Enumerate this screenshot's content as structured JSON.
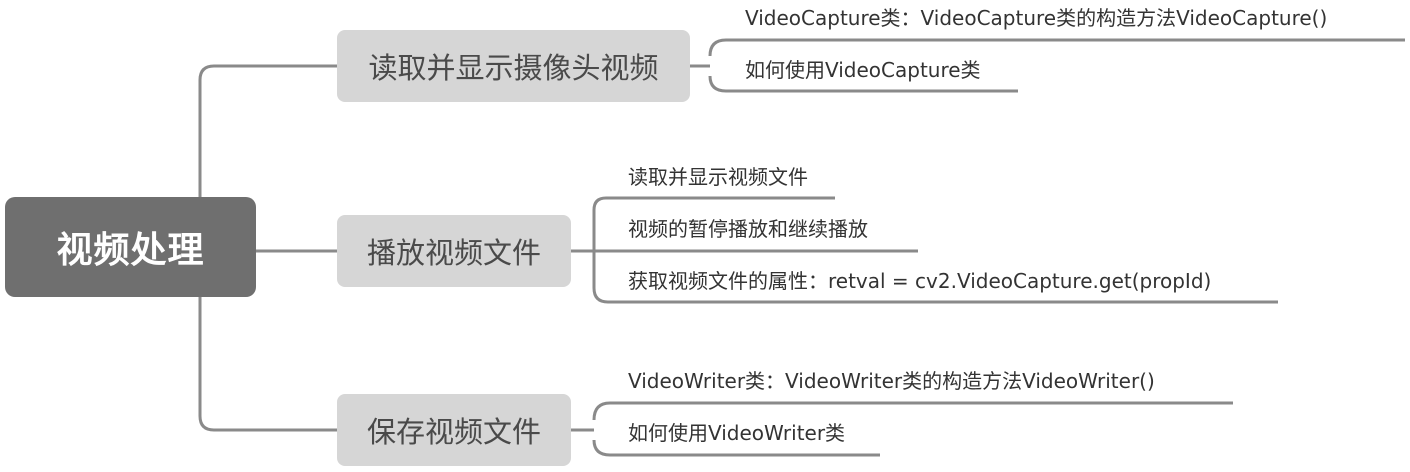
{
  "root": {
    "label": "视频处理"
  },
  "branches": [
    {
      "label": "读取并显示摄像头视频",
      "leaves": [
        "VideoCapture类：VideoCapture类的构造方法VideoCapture()",
        "如何使用VideoCapture类"
      ]
    },
    {
      "label": "播放视频文件",
      "leaves": [
        "读取并显示视频文件",
        "视频的暂停播放和继续播放",
        "获取视频文件的属性：retval = cv2.VideoCapture.get(propId)"
      ]
    },
    {
      "label": "保存视频文件",
      "leaves": [
        "VideoWriter类：VideoWriter类的构造方法VideoWriter()",
        "如何使用VideoWriter类"
      ]
    }
  ],
  "colors": {
    "root_bg": "#6f6f6f",
    "branch_bg": "#d6d6d6",
    "connector": "#8a8a8a"
  }
}
